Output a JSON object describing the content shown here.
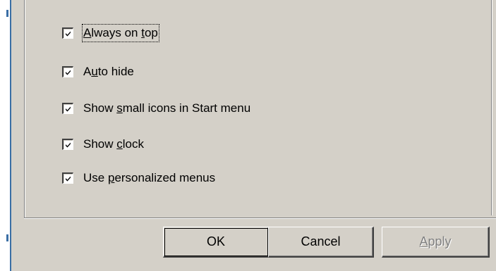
{
  "options": [
    {
      "before": "",
      "mnemonic": "A",
      "after": "lways on ",
      "mnemonic2": "t",
      "after2": "op",
      "checked": true
    },
    {
      "before": "A",
      "mnemonic": "u",
      "after": "to hide",
      "checked": true
    },
    {
      "before": "Show ",
      "mnemonic": "s",
      "after": "mall icons in Start menu",
      "checked": true
    },
    {
      "before": "Show ",
      "mnemonic": "c",
      "after": "lock",
      "checked": true
    },
    {
      "before": "Use ",
      "mnemonic": "p",
      "after": "ersonalized menus",
      "checked": true
    }
  ],
  "buttons": {
    "ok": "OK",
    "cancel": "Cancel",
    "apply_mnemonic": "A",
    "apply_rest": "pply",
    "apply_enabled": false
  },
  "colors": {
    "face": "#d4d0c8",
    "edge_accent": "#3a6ea5"
  }
}
